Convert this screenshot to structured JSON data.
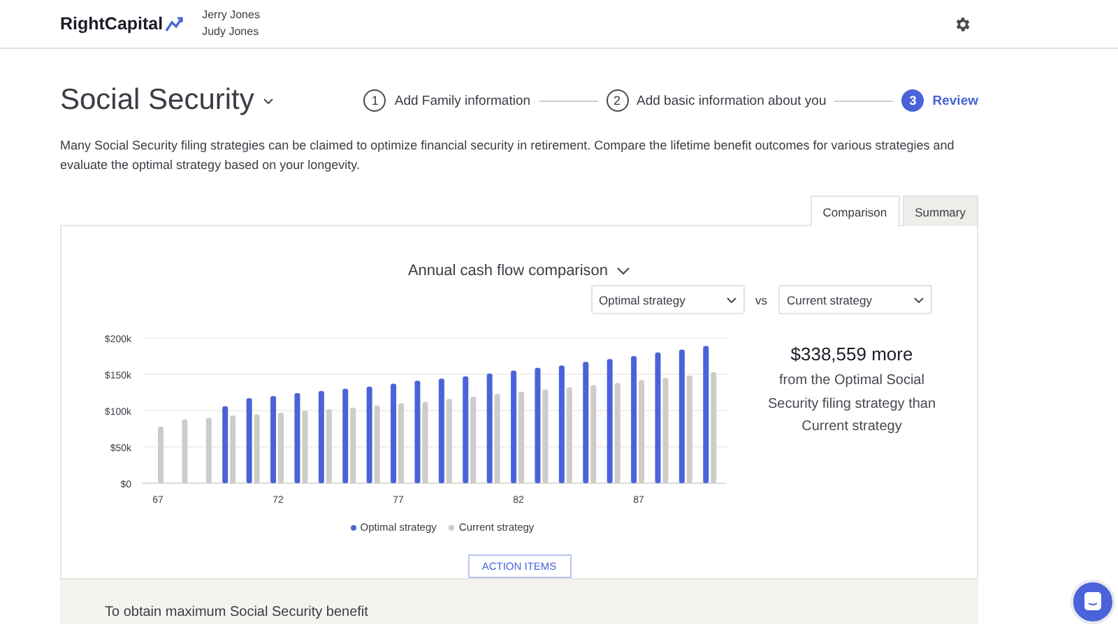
{
  "header": {
    "logo": "RightCapital",
    "users": [
      "Jerry Jones",
      "Judy Jones"
    ]
  },
  "page": {
    "title": "Social Security",
    "steps": [
      {
        "number": "1",
        "label": "Add Family information",
        "selected": false
      },
      {
        "number": "2",
        "label": "Add basic information about you",
        "selected": false
      },
      {
        "number": "3",
        "label": "Review",
        "selected": true
      }
    ],
    "description": "Many Social Security filing strategies can be claimed to optimize financial security in retirement. Compare the lifetime benefit outcomes for various strategies and evaluate the optimal strategy based on your longevity."
  },
  "tabs": [
    {
      "label": "Comparison",
      "selected": true
    },
    {
      "label": "Summary",
      "selected": false
    }
  ],
  "comparison": {
    "heading": "Annual cash flow comparison",
    "left_select": "Optimal strategy",
    "vs": "vs",
    "right_select": "Current strategy",
    "chart_data": {
      "type": "bar",
      "x": [
        67,
        68,
        69,
        70,
        71,
        72,
        73,
        74,
        75,
        76,
        77,
        78,
        79,
        80,
        81,
        82,
        83,
        84,
        85,
        86,
        87,
        88,
        89,
        90
      ],
      "grid": true,
      "stacked": false,
      "xlim": [
        66.36,
        90.66
      ],
      "series": [
        {
          "name": "Optimal strategy",
          "color": "#4a63d8",
          "values": [
            null,
            null,
            null,
            106000,
            117000,
            120000,
            124000,
            127000,
            130000,
            133000,
            137000,
            141000,
            144000,
            147000,
            151000,
            155000,
            159000,
            162000,
            167000,
            171000,
            175000,
            180000,
            184000,
            189000
          ]
        },
        {
          "name": "Current strategy",
          "color": "#cccccc",
          "values": [
            78000,
            88000,
            90000,
            93000,
            95000,
            97000,
            100000,
            102000,
            104000,
            107000,
            110000,
            112000,
            116000,
            119000,
            123000,
            126000,
            129000,
            132000,
            135000,
            138000,
            142000,
            145000,
            148000,
            153000
          ]
        }
      ],
      "ylim": [
        0,
        200000
      ],
      "yticks": [
        {
          "value": 0,
          "label": "$0"
        },
        {
          "value": 50000,
          "label": "$50k"
        },
        {
          "value": 100000,
          "label": "$100k"
        },
        {
          "value": 150000,
          "label": "$150k"
        },
        {
          "value": 200000,
          "label": "$200k"
        }
      ],
      "xticks": [
        67,
        72,
        77,
        82,
        87
      ]
    },
    "summary_amount": "$338,559 more",
    "summary_text": "from the Optimal Social Security filing strategy than Current strategy",
    "action_button": "ACTION ITEMS"
  },
  "action_section": {
    "heading": "To obtain maximum Social Security benefit"
  }
}
